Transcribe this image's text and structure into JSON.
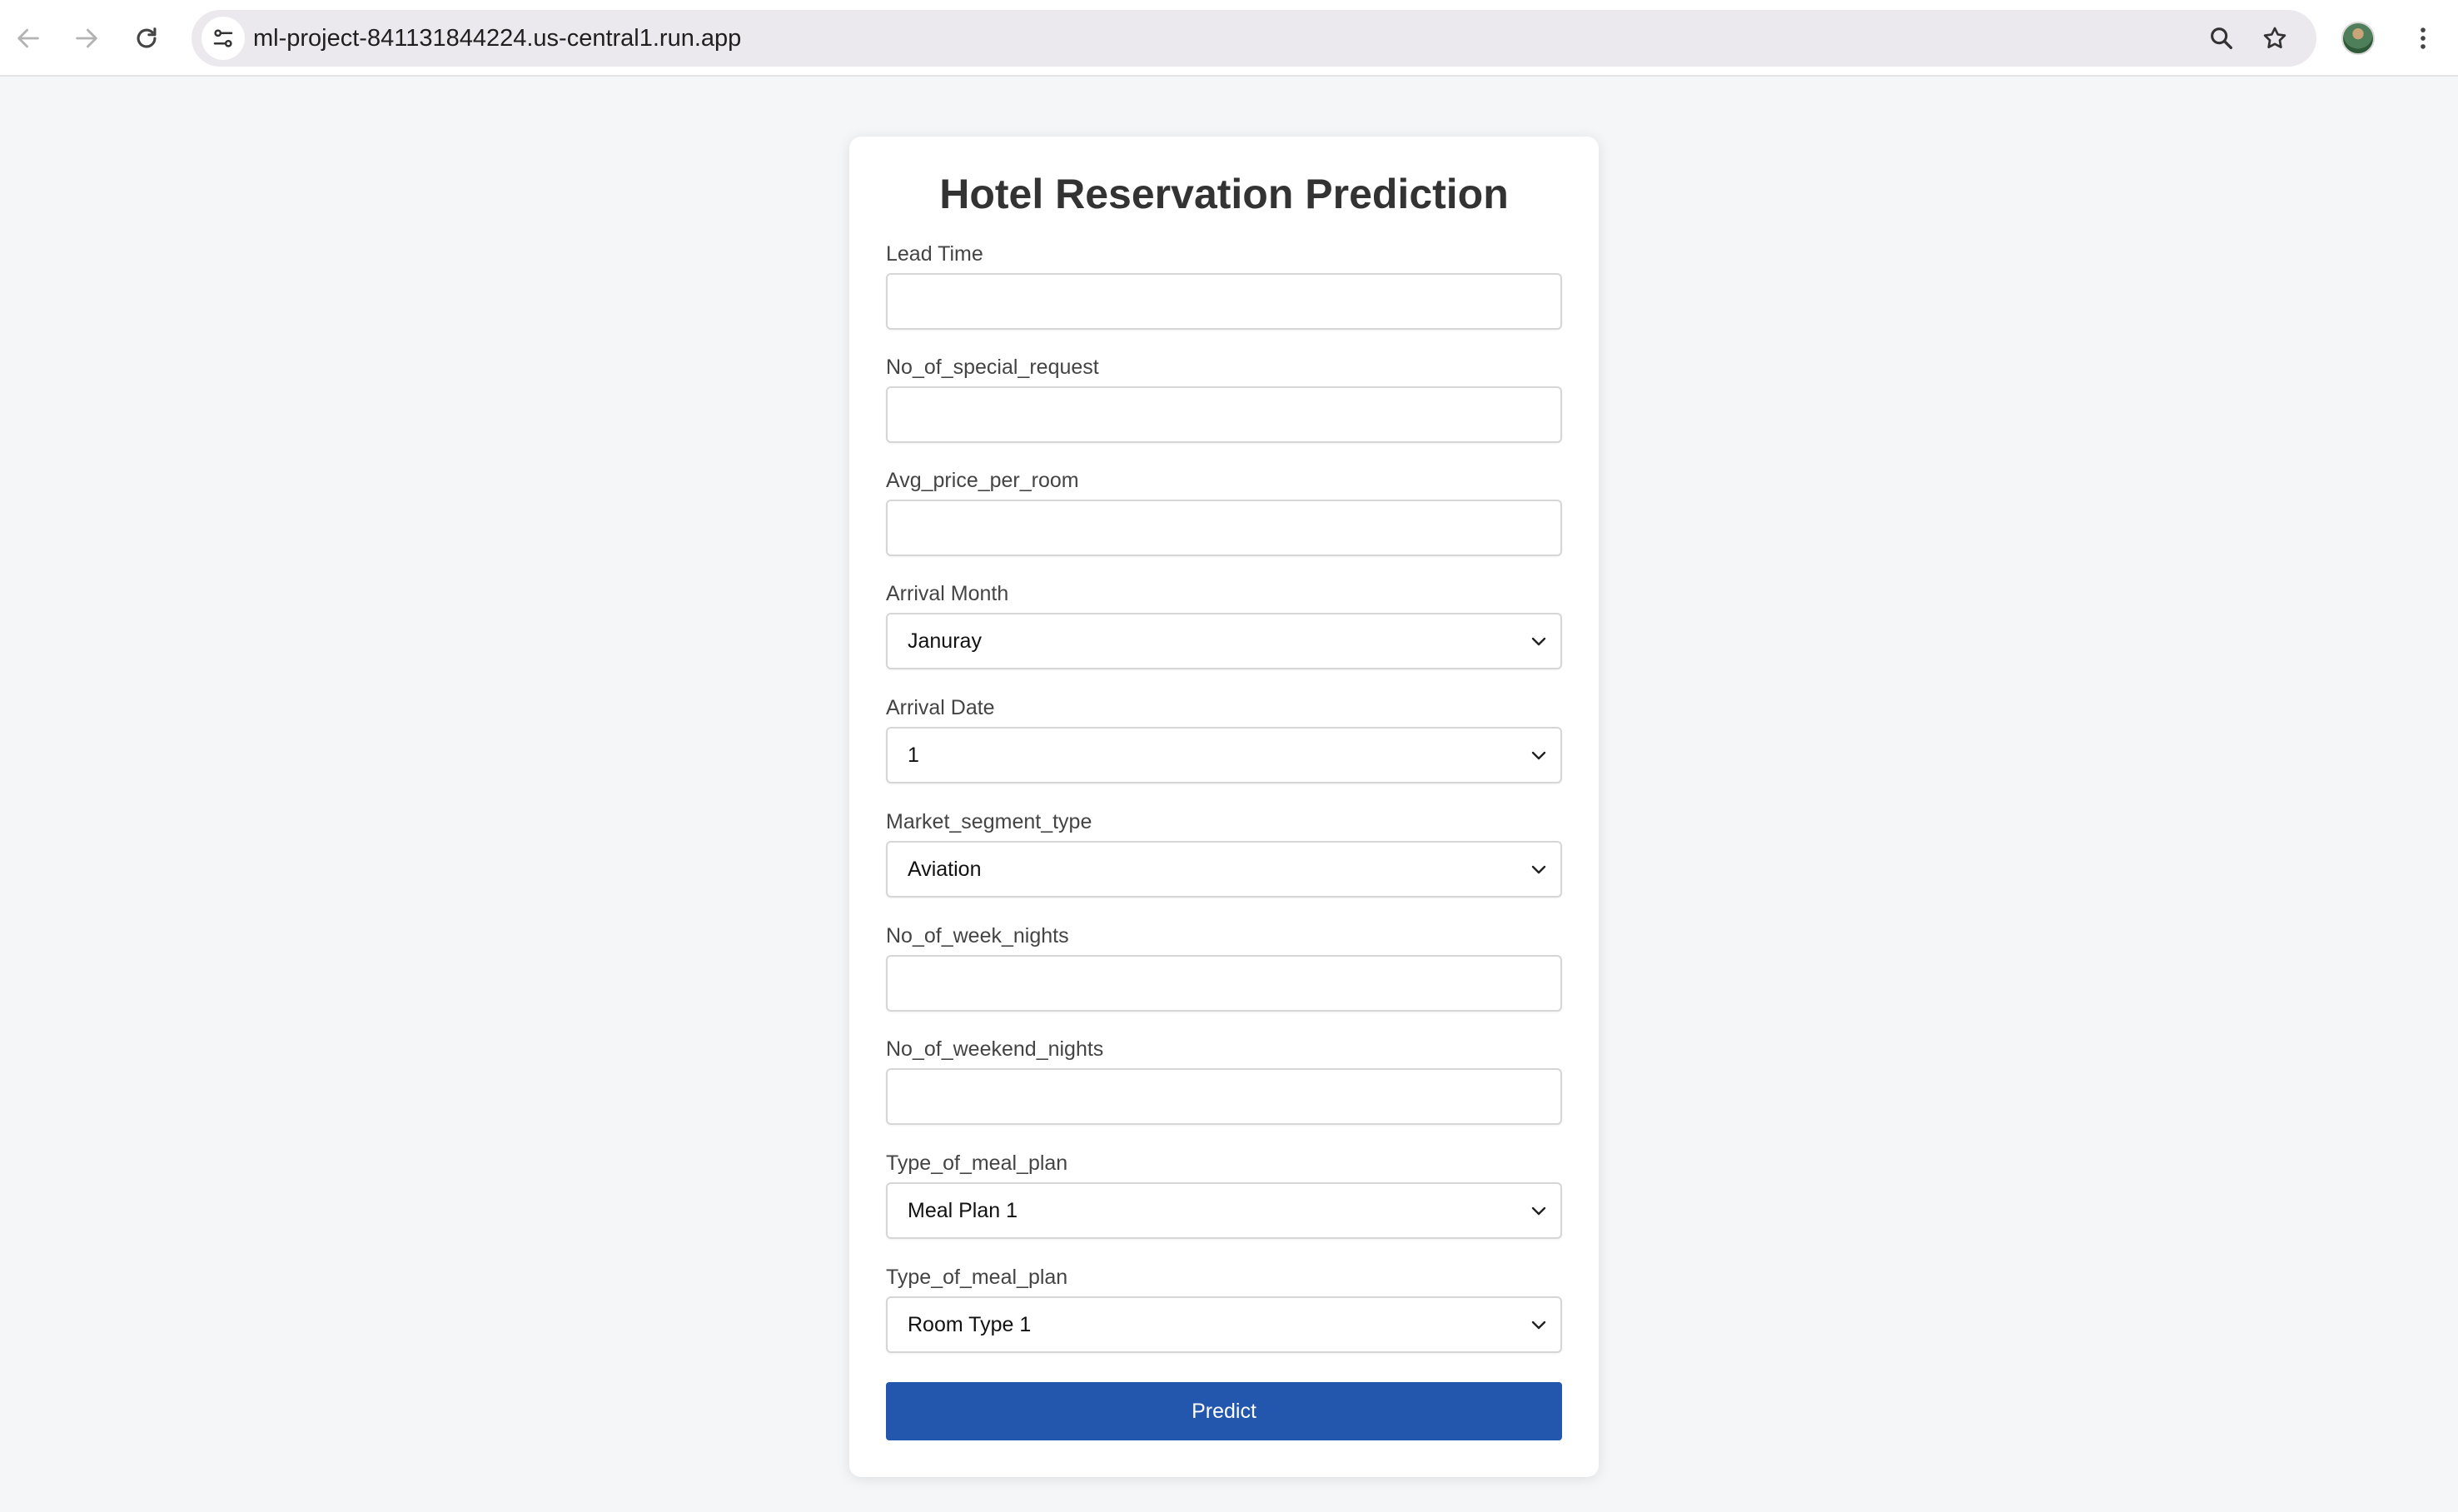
{
  "browser": {
    "url": "ml-project-841131844224.us-central1.run.app",
    "icons": [
      "back-arrow-icon",
      "forward-arrow-icon",
      "reload-icon",
      "site-settings-icon",
      "zoom-icon",
      "bookmark-star-icon",
      "profile-avatar",
      "more-menu-icon"
    ]
  },
  "form": {
    "title": "Hotel Reservation Prediction",
    "fields": [
      {
        "label": "Lead Time",
        "type": "input",
        "value": ""
      },
      {
        "label": "No_of_special_request",
        "type": "input",
        "value": ""
      },
      {
        "label": "Avg_price_per_room",
        "type": "input",
        "value": ""
      },
      {
        "label": "Arrival Month",
        "type": "select",
        "value": "Januray"
      },
      {
        "label": "Arrival Date",
        "type": "select",
        "value": "1"
      },
      {
        "label": "Market_segment_type",
        "type": "select",
        "value": "Aviation"
      },
      {
        "label": "No_of_week_nights",
        "type": "input",
        "value": ""
      },
      {
        "label": "No_of_weekend_nights",
        "type": "input",
        "value": ""
      },
      {
        "label": "Type_of_meal_plan",
        "type": "select",
        "value": "Meal Plan 1"
      },
      {
        "label": "Type_of_meal_plan",
        "type": "select",
        "value": "Room Type 1"
      }
    ],
    "submit_label": "Predict"
  },
  "colors": {
    "button": "#2356ad",
    "page_background": "#f4f6f8",
    "card_background": "#ffffff",
    "title": "#333333"
  }
}
